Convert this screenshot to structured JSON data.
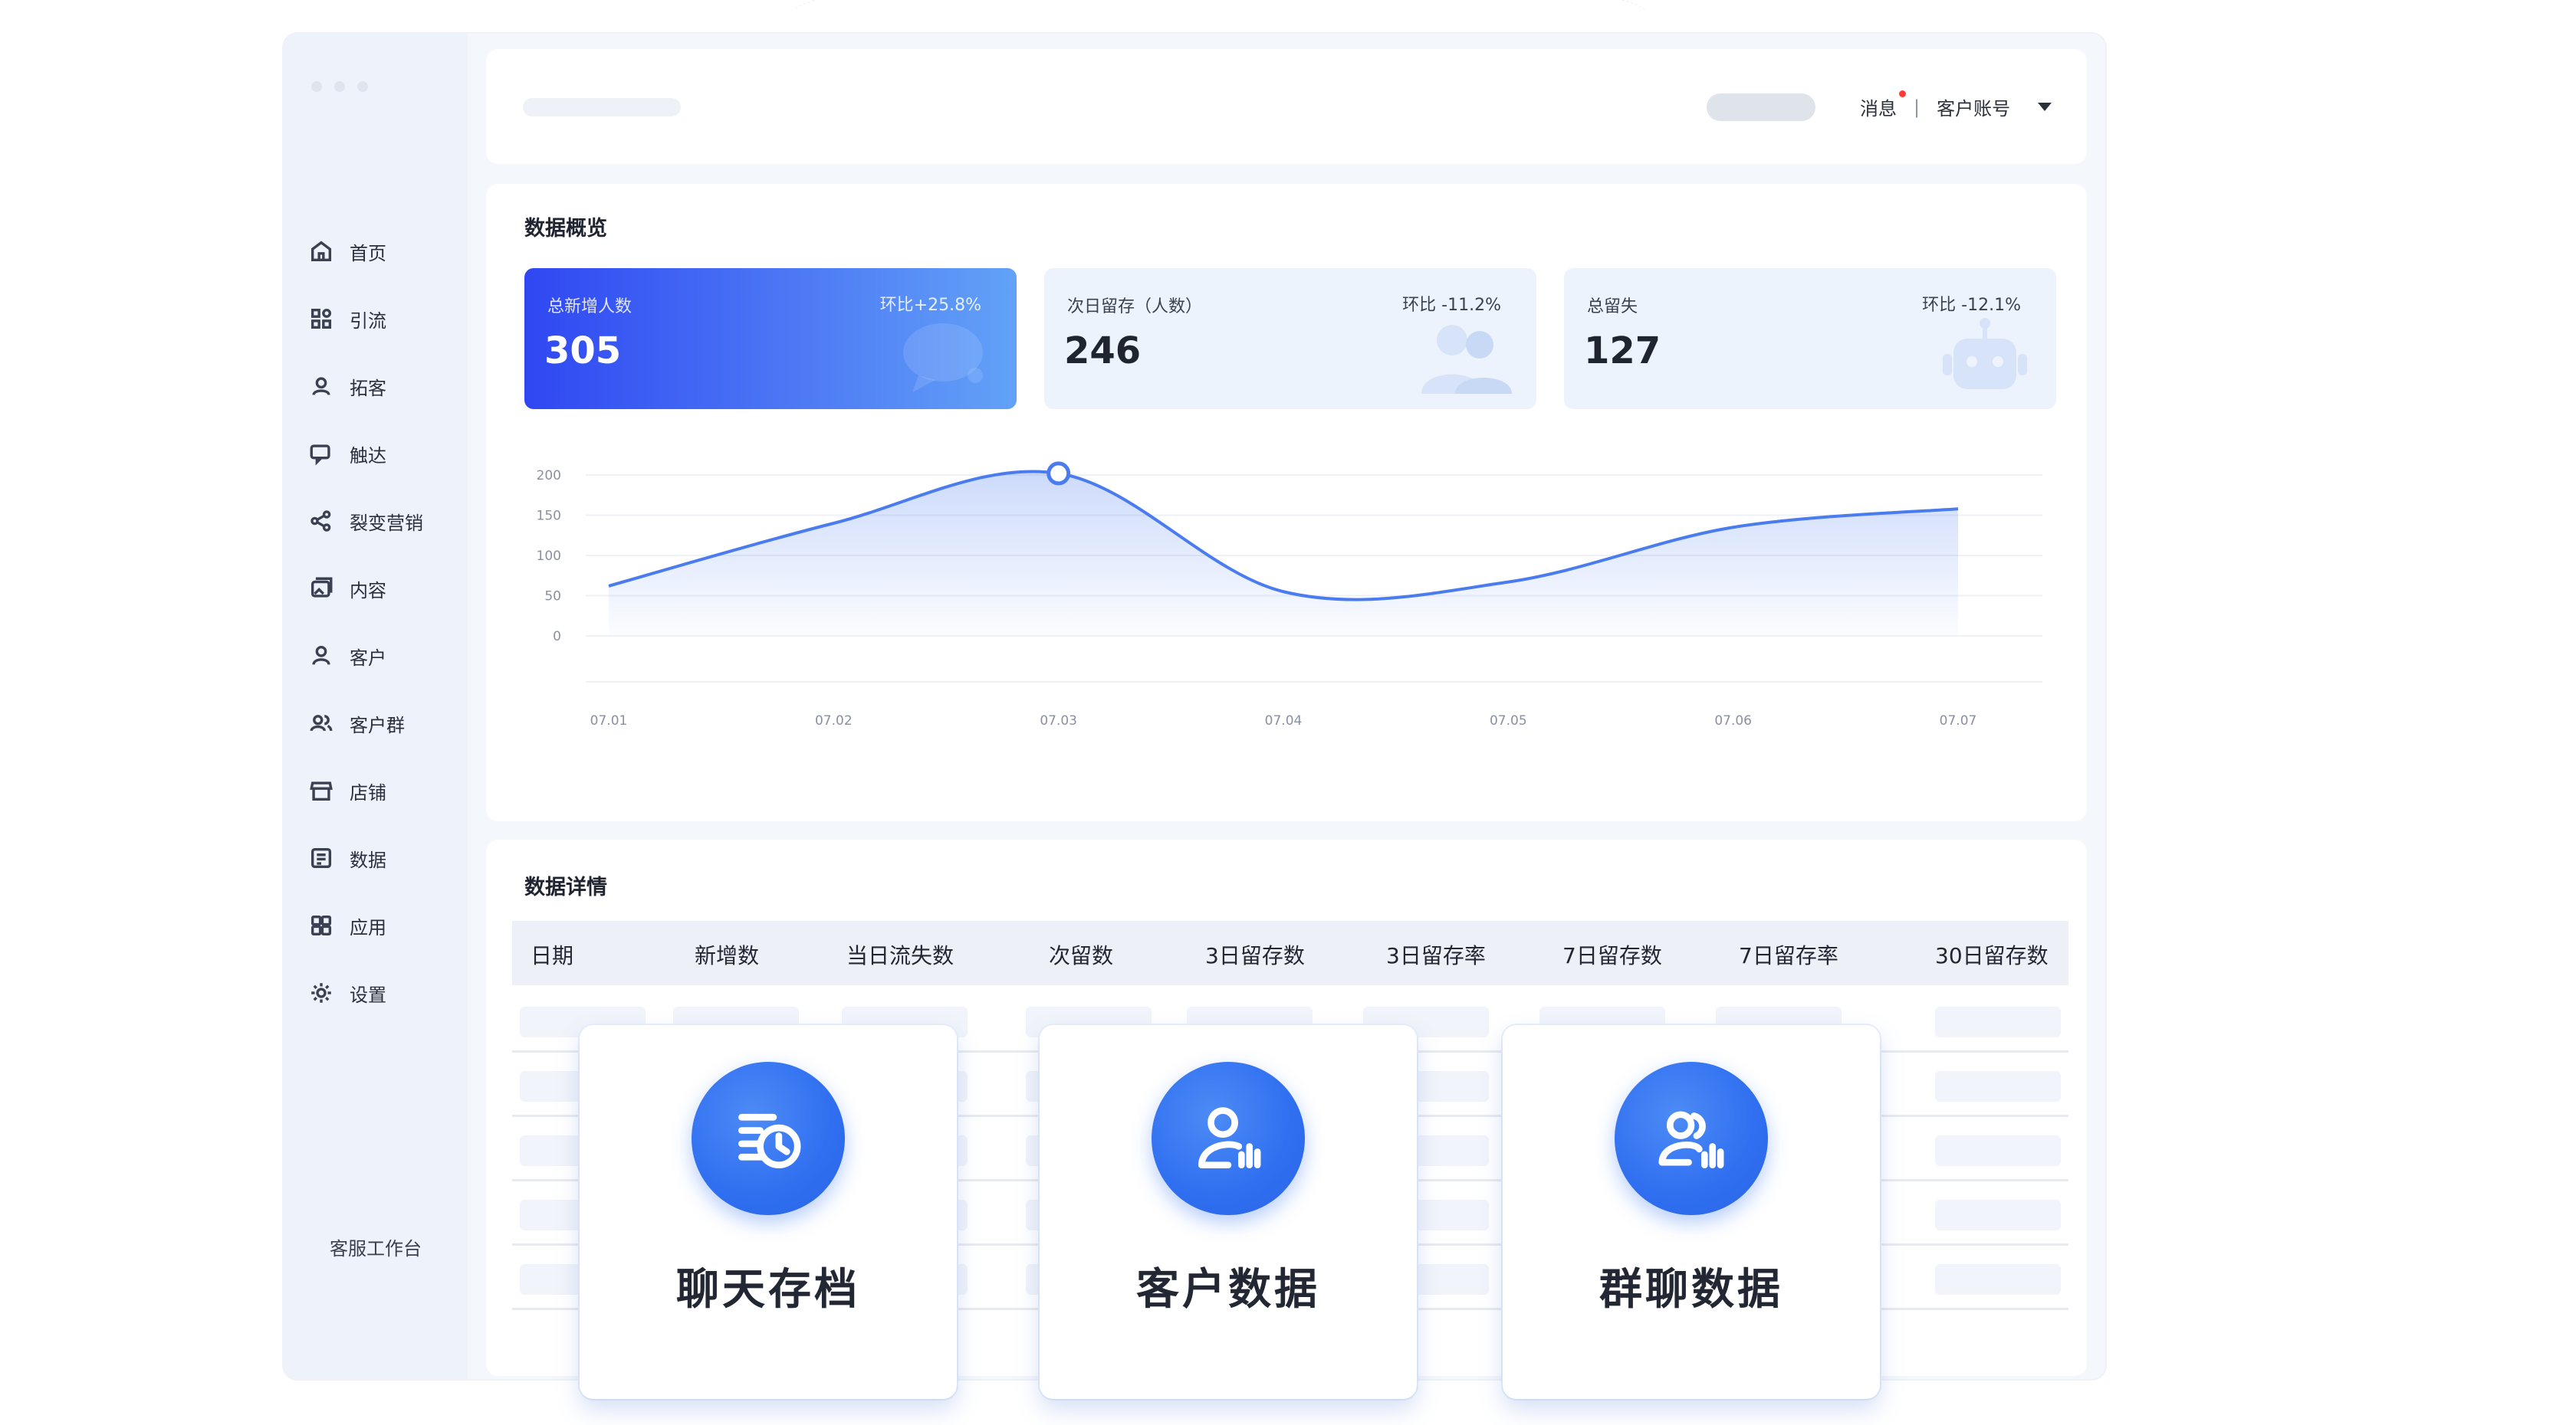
{
  "header": {
    "message_label": "消息",
    "separator": "|",
    "account_label": "客户账号"
  },
  "sidebar": {
    "items": [
      {
        "label": "首页",
        "icon": "home-icon"
      },
      {
        "label": "引流",
        "icon": "grid-icon"
      },
      {
        "label": "拓客",
        "icon": "user-icon"
      },
      {
        "label": "触达",
        "icon": "chat-icon"
      },
      {
        "label": "裂变营销",
        "icon": "share-icon"
      },
      {
        "label": "内容",
        "icon": "gallery-icon"
      },
      {
        "label": "客户",
        "icon": "person-icon"
      },
      {
        "label": "客户群",
        "icon": "group-icon"
      },
      {
        "label": "店铺",
        "icon": "store-icon"
      },
      {
        "label": "数据",
        "icon": "data-icon"
      },
      {
        "label": "应用",
        "icon": "apps-icon"
      },
      {
        "label": "设置",
        "icon": "gear-icon"
      }
    ],
    "bottom_label": "客服工作台"
  },
  "overview": {
    "title": "数据概览",
    "cards": [
      {
        "label": "总新增人数",
        "change": "环比+25.8%",
        "value": "305",
        "icon": "chat-bubble-icon"
      },
      {
        "label": "次日留存（人数）",
        "change": "环比 -11.2%",
        "value": "246",
        "icon": "users-icon"
      },
      {
        "label": "总留失",
        "change": "环比 -12.1%",
        "value": "127",
        "icon": "robot-icon"
      }
    ]
  },
  "chart_data": {
    "type": "line",
    "x": [
      "07.01",
      "07.02",
      "07.03",
      "07.04",
      "07.05",
      "07.06",
      "07.07"
    ],
    "y_ticks": [
      0,
      50,
      100,
      150,
      200
    ],
    "ylim": [
      0,
      200
    ],
    "series": [
      {
        "values": [
          62,
          140,
          202,
          55,
          67,
          135,
          158
        ]
      }
    ],
    "highlight_index": 2,
    "line_color": "#4a7cf0"
  },
  "details": {
    "title": "数据详情",
    "columns": [
      "日期",
      "新增数",
      "当日流失数",
      "次留数",
      "3日留存数",
      "3日留存率",
      "7日留存数",
      "7日留存率",
      "30日留存数"
    ]
  },
  "features": [
    {
      "label": "聊天存档",
      "icon": "chat-archive-icon"
    },
    {
      "label": "客户数据",
      "icon": "customer-data-icon"
    },
    {
      "label": "群聊数据",
      "icon": "group-data-icon"
    }
  ]
}
